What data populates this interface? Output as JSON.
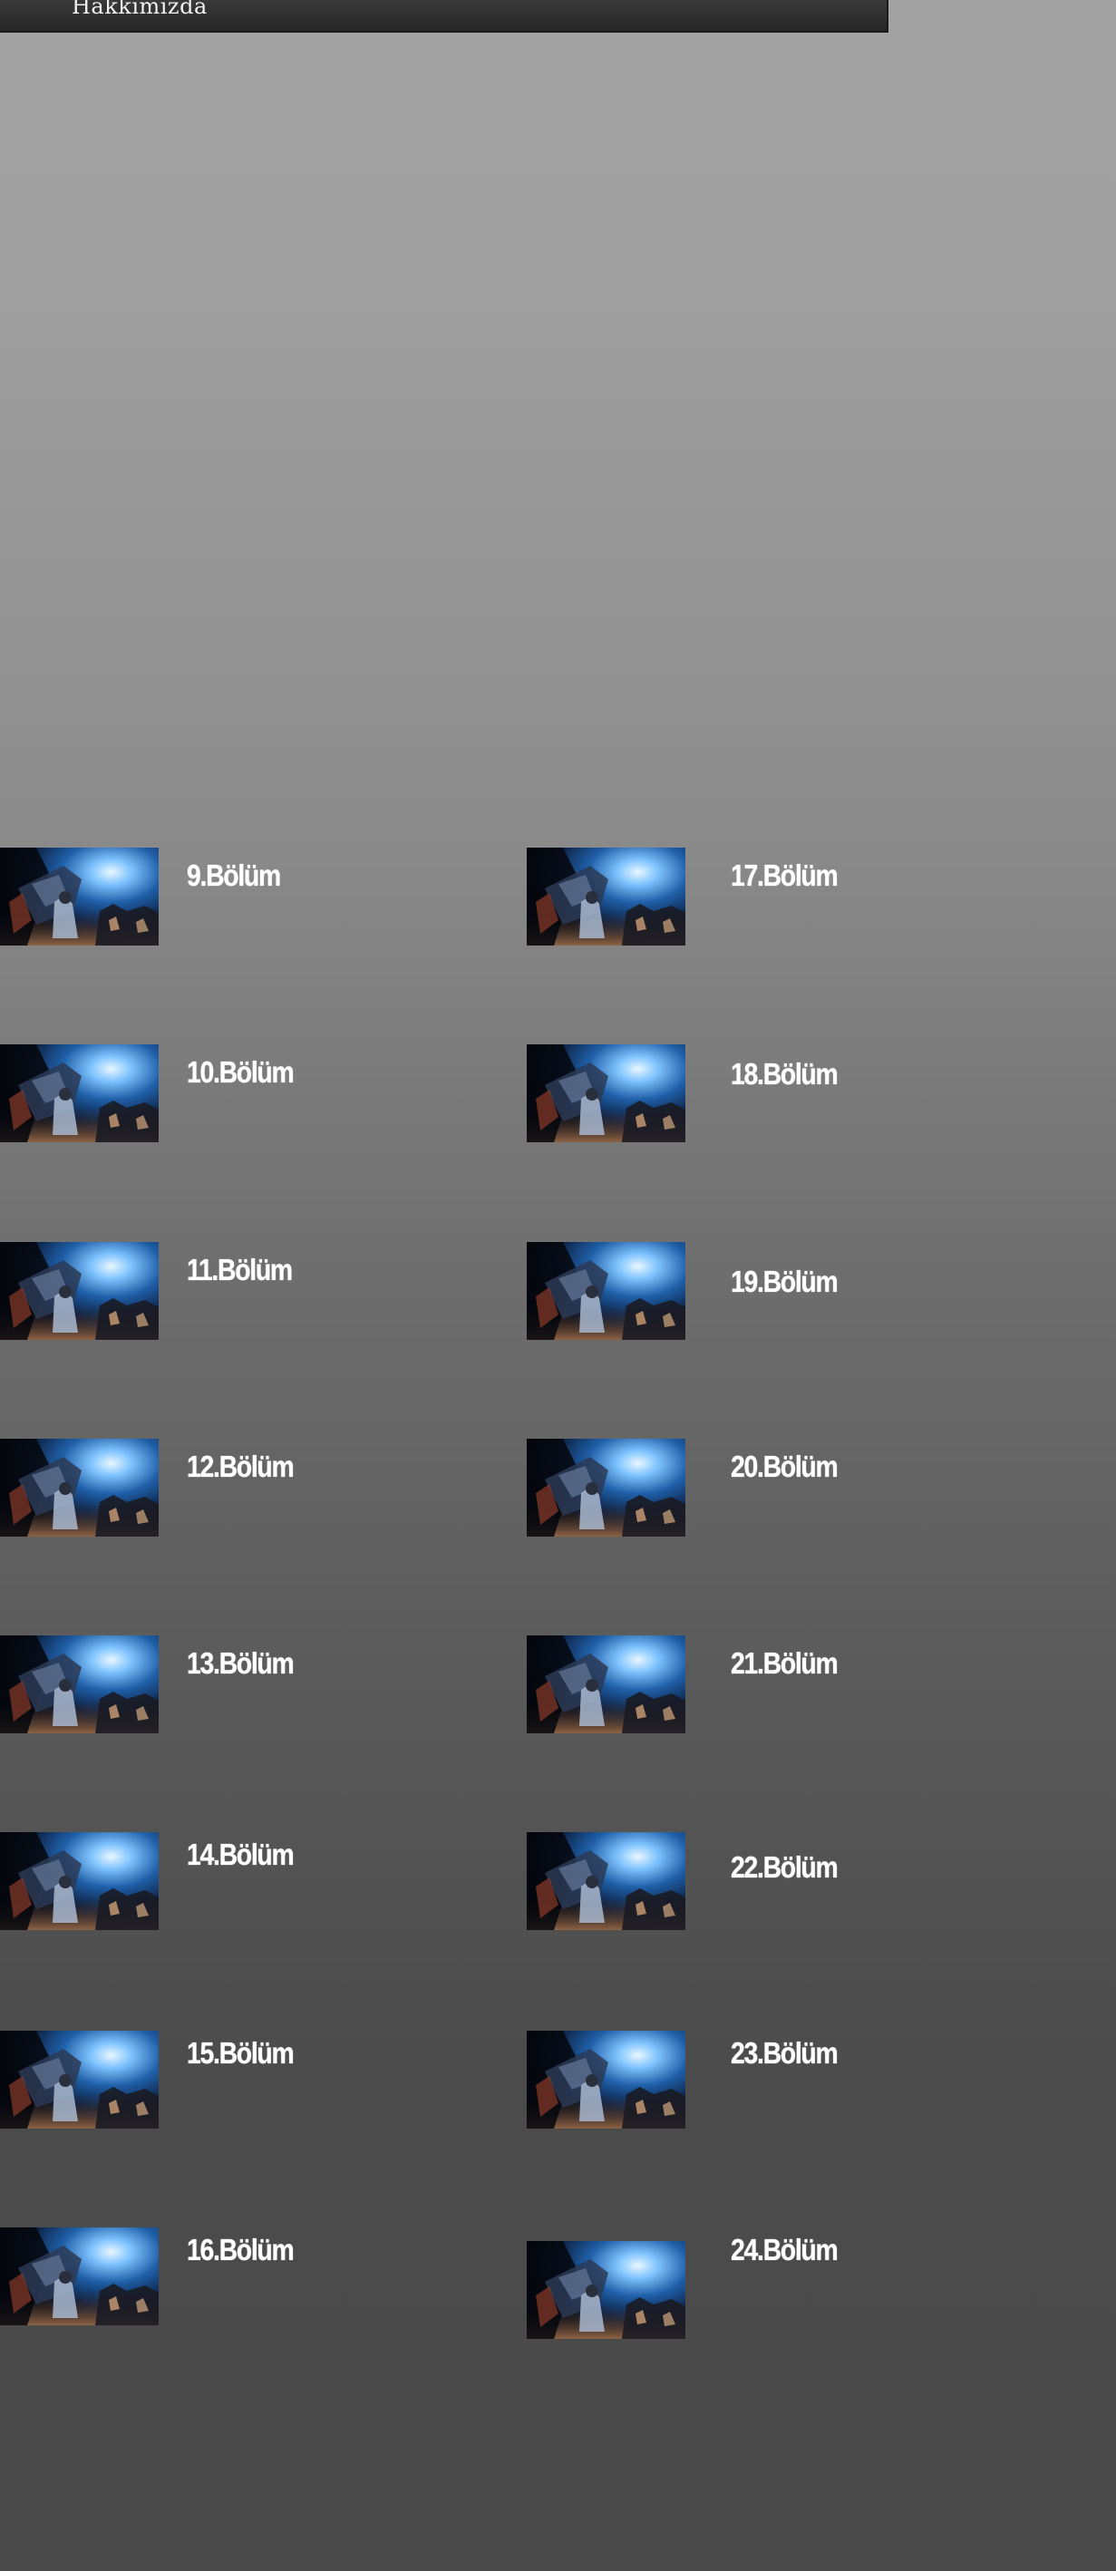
{
  "nav": {
    "about_label": "Hakkımızda"
  },
  "thumbnail_icon": "anime-episode-thumbnail",
  "episodes_left": [
    {
      "label": "9.Bölüm"
    },
    {
      "label": "10.Bölüm"
    },
    {
      "label": "11.Bölüm"
    },
    {
      "label": "12.Bölüm"
    },
    {
      "label": "13.Bölüm"
    },
    {
      "label": "14.Bölüm"
    },
    {
      "label": "15.Bölüm"
    },
    {
      "label": "16.Bölüm"
    }
  ],
  "episodes_right": [
    {
      "label": "17.Bölüm"
    },
    {
      "label": "18.Bölüm"
    },
    {
      "label": "19.Bölüm"
    },
    {
      "label": "20.Bölüm"
    },
    {
      "label": "21.Bölüm"
    },
    {
      "label": "22.Bölüm"
    },
    {
      "label": "23.Bölüm"
    },
    {
      "label": "24.Bölüm"
    }
  ]
}
